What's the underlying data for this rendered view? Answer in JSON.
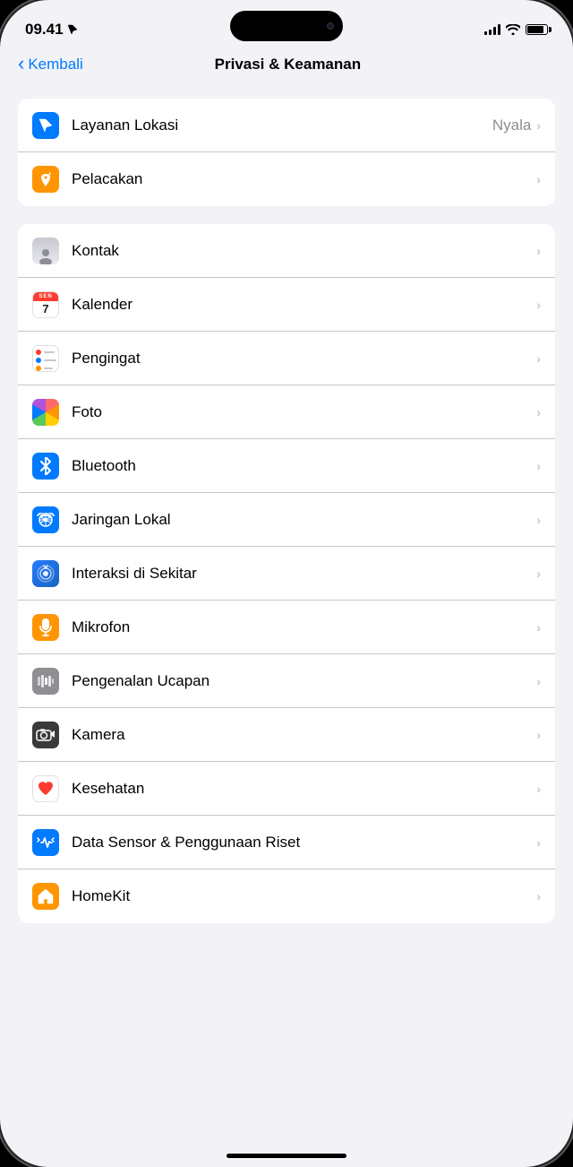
{
  "status": {
    "time": "09.41",
    "location_icon": "location-arrow",
    "battery_level": 85
  },
  "nav": {
    "back_label": "Kembali",
    "title": "Privasi & Keamanan"
  },
  "sections": [
    {
      "id": "section-location",
      "rows": [
        {
          "id": "layanan-lokasi",
          "label": "Layanan Lokasi",
          "value": "Nyala",
          "icon_bg": "blue",
          "icon_type": "location"
        },
        {
          "id": "pelacakan",
          "label": "Pelacakan",
          "value": "",
          "icon_bg": "orange",
          "icon_type": "tracking"
        }
      ]
    },
    {
      "id": "section-apps",
      "rows": [
        {
          "id": "kontak",
          "label": "Kontak",
          "value": "",
          "icon_type": "contacts"
        },
        {
          "id": "kalender",
          "label": "Kalender",
          "value": "",
          "icon_type": "calendar"
        },
        {
          "id": "pengingat",
          "label": "Pengingat",
          "value": "",
          "icon_type": "reminders"
        },
        {
          "id": "foto",
          "label": "Foto",
          "value": "",
          "icon_type": "photos"
        },
        {
          "id": "bluetooth",
          "label": "Bluetooth",
          "value": "",
          "icon_type": "bluetooth"
        },
        {
          "id": "jaringan-lokal",
          "label": "Jaringan Lokal",
          "value": "",
          "icon_type": "local-network"
        },
        {
          "id": "interaksi-di-sekitar",
          "label": "Interaksi di Sekitar",
          "value": "",
          "icon_type": "nearby-interaction"
        },
        {
          "id": "mikrofon",
          "label": "Mikrofon",
          "value": "",
          "icon_type": "microphone"
        },
        {
          "id": "pengenalan-ucapan",
          "label": "Pengenalan Ucapan",
          "value": "",
          "icon_type": "speech"
        },
        {
          "id": "kamera",
          "label": "Kamera",
          "value": "",
          "icon_type": "camera"
        },
        {
          "id": "kesehatan",
          "label": "Kesehatan",
          "value": "",
          "icon_type": "health"
        },
        {
          "id": "data-sensor",
          "label": "Data Sensor & Penggunaan Riset",
          "value": "",
          "icon_type": "sensor"
        },
        {
          "id": "homekit",
          "label": "HomeKit",
          "value": "",
          "icon_type": "homekit"
        }
      ]
    }
  ],
  "chevron": "›",
  "back_chevron": "‹"
}
